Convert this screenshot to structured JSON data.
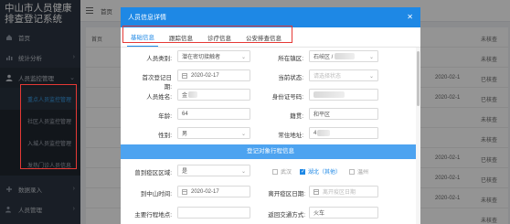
{
  "app": {
    "title": "中山市人员健康排查登记系统"
  },
  "sidebar": {
    "items": [
      {
        "label": "首页"
      },
      {
        "label": "统计分析"
      },
      {
        "label": "人员监控管理"
      },
      {
        "label": "数据录入"
      },
      {
        "label": "人员管理"
      }
    ],
    "sub_items": [
      {
        "label": "重点人员监控管理"
      },
      {
        "label": "社区人员监控管理"
      },
      {
        "label": "入城人员监控管理"
      },
      {
        "label": "发热门诊人员信息"
      }
    ]
  },
  "topbar": {
    "first_tab": "首页"
  },
  "background_table": {
    "rows": [
      {
        "left": "首页",
        "date": "",
        "status": "未核查"
      },
      {
        "left": "",
        "date": "",
        "status": "未核查"
      },
      {
        "left": "",
        "date": "2020-02-1",
        "status": "已核查"
      },
      {
        "left": "",
        "date": "2020-02-1",
        "status": "已核查"
      },
      {
        "left": "",
        "date": "",
        "status": "未核查"
      },
      {
        "left": "",
        "date": "",
        "status": "未核查"
      },
      {
        "left": "",
        "date": "2020-02-1",
        "status": "已核查"
      },
      {
        "left": "",
        "date": "2020-02-1",
        "status": "已核查"
      },
      {
        "left": "",
        "date": "2020-02-1",
        "status": "未核查"
      },
      {
        "left": "",
        "date": "",
        "status": "未核查"
      }
    ]
  },
  "modal": {
    "title": "人员信息详情",
    "close_icon": "close-icon",
    "tabs": [
      "基础信息",
      "跟踪信息",
      "诊疗信息",
      "公安排查信息"
    ],
    "fields": {
      "person_type_label": "人员类别:",
      "person_type_value": "潜在密切接触者",
      "district_label": "所在镇区:",
      "district_value": "石岐区 / ",
      "first_reg_date_label": "首次登记日期:",
      "first_reg_date_value": "2020-02-17",
      "current_status_label": "当前状态:",
      "current_status_placeholder": "请选择状态",
      "name_label": "人员姓名:",
      "name_value": "金",
      "id_label": "身份证号码:",
      "age_label": "年龄:",
      "age_value": "64",
      "nationality_label": "籍贯:",
      "nationality_value": "和平区",
      "gender_label": "性别:",
      "gender_value": "男",
      "address_label": "常住地址:",
      "address_value": "4"
    },
    "section_title": "登记对象行程信息",
    "travel": {
      "visited_label": "曾到疫区区域:",
      "visited_value": "是",
      "wuhan": "武汉",
      "hubei": "湖北（其他）",
      "wenzhou": "温州",
      "arrival_label": "到中山时间:",
      "arrival_value": "2020-02-17",
      "leave_label": "离开疫区日期:",
      "leave_placeholder": "离开疫区日期",
      "vehicle_label": "主要行程地点:",
      "transport_label": "返回交通方式:",
      "transport_value": "火车"
    }
  },
  "colors": {
    "accent": "#1e88e5",
    "sidebar_bg": "#2c3542",
    "highlight_box": "#e53935"
  }
}
